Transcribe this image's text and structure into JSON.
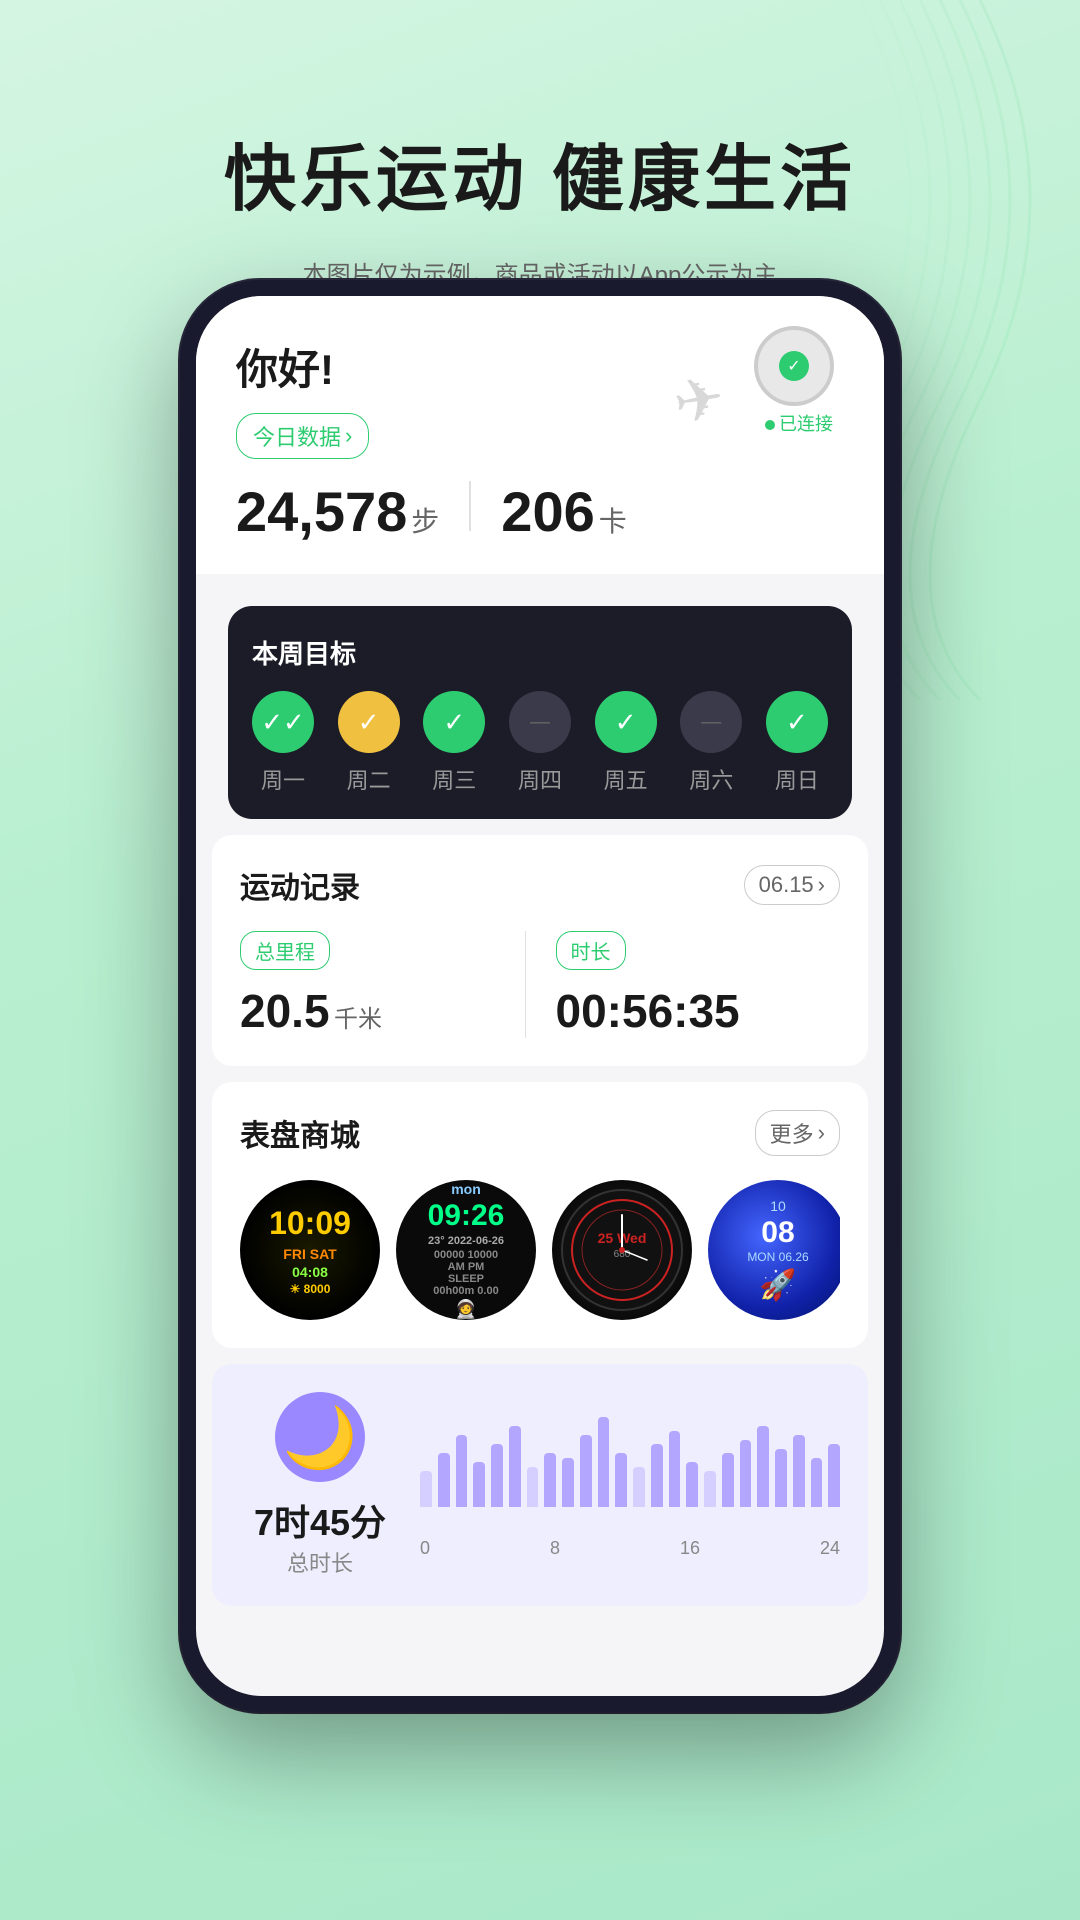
{
  "page": {
    "background_color": "#c8f0d8",
    "title": "快乐运动 健康生活",
    "disclaimer": "本图片仅为示例，商品或活动以App公示为主"
  },
  "header": {
    "greeting": "你好!",
    "today_btn": "今日数据",
    "chevron": "›",
    "steps_count": "24,578",
    "steps_unit": "步",
    "calories": "206",
    "calories_unit": "卡",
    "watch_connected": "已连接"
  },
  "weekly_goals": {
    "title": "本周目标",
    "days": [
      {
        "label": "周一",
        "status": "green"
      },
      {
        "label": "周二",
        "status": "yellow"
      },
      {
        "label": "周三",
        "status": "green"
      },
      {
        "label": "周四",
        "status": "dark"
      },
      {
        "label": "周五",
        "status": "green"
      },
      {
        "label": "周六",
        "status": "dark"
      },
      {
        "label": "周日",
        "status": "green"
      }
    ]
  },
  "exercise_record": {
    "title": "运动记录",
    "date": "06.15",
    "chevron": "›",
    "distance_label": "总里程",
    "distance_value": "20.5",
    "distance_unit": "千米",
    "duration_label": "时长",
    "duration_value": "00:56:35"
  },
  "watch_store": {
    "title": "表盘商城",
    "more_label": "更多",
    "chevron": "›",
    "faces": [
      {
        "id": "face1",
        "time": "10:09",
        "day": "FRI SAT",
        "color": "#ffcc00"
      },
      {
        "id": "face2",
        "time": "09:26",
        "date": "23° 2022-06-26",
        "color": "#00ff88"
      },
      {
        "id": "face3",
        "brand": "680",
        "color": "#cc2222"
      },
      {
        "id": "face4",
        "time": "10 08",
        "label": "MON 06.26",
        "color": "#4466ff"
      }
    ]
  },
  "sleep": {
    "icon": "🌙",
    "hours": "7",
    "hours_unit": "时",
    "minutes": "45",
    "minutes_unit": "分",
    "label": "总时长",
    "chart_labels": [
      "0",
      "8",
      "16",
      "24"
    ],
    "bars": [
      40,
      60,
      80,
      50,
      70,
      90,
      45,
      60,
      55,
      80,
      100,
      60,
      45,
      70,
      85,
      50,
      40,
      60,
      75,
      90,
      65,
      80,
      55,
      70
    ]
  }
}
